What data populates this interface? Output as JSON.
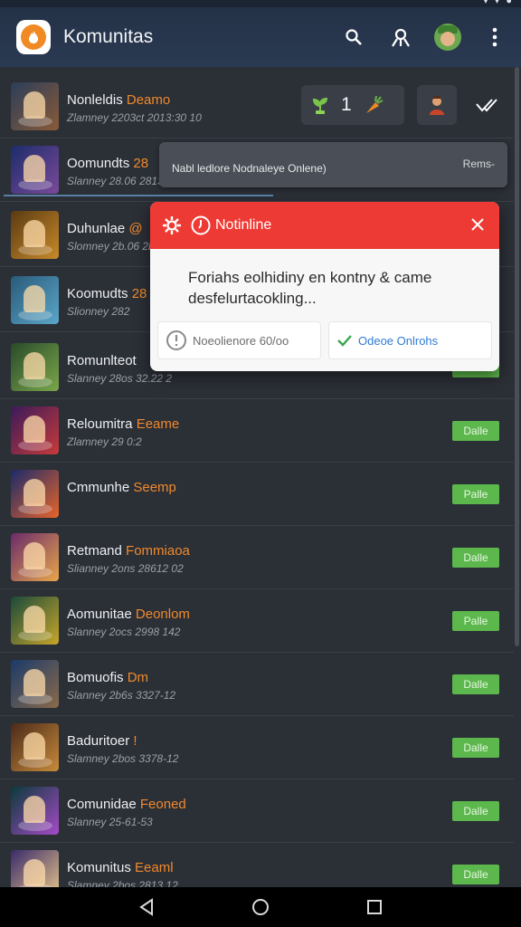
{
  "app": {
    "title": "Komunitas",
    "accent_color": "#f08a24",
    "header_icons": [
      "search-icon",
      "profile-network-icon",
      "user-avatar",
      "more-vert-icon"
    ]
  },
  "top_widgets": {
    "count": "1"
  },
  "banner": {
    "text": "Nabl ledlore Nodnaleye Onlene)",
    "right": "Rems-"
  },
  "dialog": {
    "title": "Notinline",
    "body": "Foriahs eolhidiny en kontny & came desfelurtacokling...",
    "neutral_button": "Noeolienore 60/oo",
    "confirm_button": "Odeoe Onlrohs",
    "header_color": "#ee3a34"
  },
  "rows": [
    {
      "title": "Nonleldis ",
      "highlight": "Deamo",
      "subtitle": "Zlamney 2203ct 2013:30 10",
      "join": "",
      "colors": [
        "#2a3e5a",
        "#8a5a38"
      ]
    },
    {
      "title": "Oomundts ",
      "highlight": "28",
      "subtitle": "Slanney 28.06 2813 2",
      "join": "",
      "colors": [
        "#1c2c6a",
        "#7a4a9a"
      ]
    },
    {
      "title": "Duhunlae ",
      "highlight": "@",
      "subtitle": "Slomney 2b.06 2b5",
      "join": "",
      "colors": [
        "#5a3a12",
        "#c88a2a"
      ]
    },
    {
      "title": "Koomudts ",
      "highlight": "28",
      "subtitle": "Slionney 282",
      "join": "Dalle",
      "colors": [
        "#2a5a7a",
        "#5aa6c8"
      ]
    },
    {
      "title": "Romunlteot ",
      "highlight": "",
      "subtitle": "Slanney 28os 32.22 2",
      "join": "Dalle",
      "colors": [
        "#2a4a2a",
        "#7aa64a"
      ]
    },
    {
      "title": "Reloumitra ",
      "highlight": "Eeame",
      "subtitle": "Zlamney 29 0:2",
      "join": "Dalle",
      "colors": [
        "#3a1a5a",
        "#c83a3a"
      ]
    },
    {
      "title": "Cmmunhe ",
      "highlight": "Seemp",
      "subtitle": "",
      "join": "Palle",
      "colors": [
        "#1a2a6a",
        "#e8642a"
      ]
    },
    {
      "title": "Retmand ",
      "highlight": "Fommiaoa",
      "subtitle": "Slianney 2ons 28612 02",
      "join": "Dalle",
      "colors": [
        "#6a2a6a",
        "#e8a64a"
      ]
    },
    {
      "title": "Aomunitae ",
      "highlight": "Deonlom",
      "subtitle": "Slanney 2ocs 2998 142",
      "join": "Palle",
      "colors": [
        "#1a4a3a",
        "#c8a62a"
      ]
    },
    {
      "title": "Bomuofis ",
      "highlight": "Dm",
      "subtitle": "Slanney 2b6s 3327-12",
      "join": "Dalle",
      "colors": [
        "#1a3a6a",
        "#8a6a4a"
      ]
    },
    {
      "title": "Baduritoer ",
      "highlight": "!",
      "subtitle": "Slamney 2bos 3378-12",
      "join": "Dalle",
      "colors": [
        "#4a2a1a",
        "#c88a3a"
      ]
    },
    {
      "title": "Comunidae ",
      "highlight": "Feoned",
      "subtitle": "Slanney 25-61-53",
      "join": "Dalle",
      "colors": [
        "#0a3a3a",
        "#a64ac8"
      ]
    },
    {
      "title": "Komunitus ",
      "highlight": "Eeaml",
      "subtitle": "Slamney 2bos 2813 12",
      "join": "Dalle",
      "colors": [
        "#3a2a6a",
        "#e8c88a"
      ]
    }
  ],
  "nav": [
    "back-icon",
    "home-icon",
    "recents-icon"
  ]
}
